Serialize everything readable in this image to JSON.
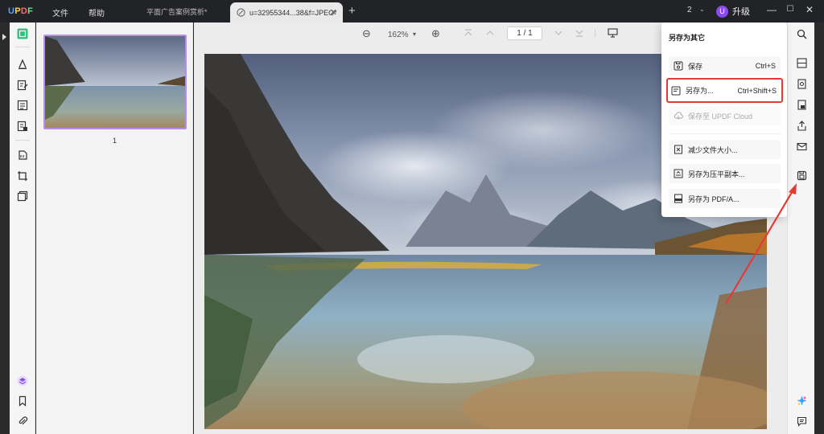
{
  "app": {
    "logo": {
      "p1": "U",
      "p2": "P",
      "p3": "D",
      "p4": "F"
    },
    "menu": {
      "file": "文件",
      "help": "帮助"
    },
    "tabs": [
      {
        "label": "平面广告案例赏析*"
      },
      {
        "label": "u=32955344...38&f=JPEG*"
      }
    ],
    "new_tab": "+",
    "tab_count": "2",
    "tab_count_caret": "⌄",
    "upgrade": {
      "avatar": "U",
      "label": "升级"
    },
    "window": {
      "minimize": "—",
      "maximize": "☐",
      "close": "✕"
    }
  },
  "viewer": {
    "zoom_out": "⊖",
    "zoom_level": "162%",
    "zoom_caret": "▾",
    "zoom_in": "⊕",
    "page_indicator": "1 / 1",
    "thumbnail_page_number": "1"
  },
  "save_popup": {
    "title": "另存为其它",
    "items": [
      {
        "label": "保存",
        "shortcut": "Ctrl+S",
        "icon": "save-icon",
        "enabled": true
      },
      {
        "label": "另存为...",
        "shortcut": "Ctrl+Shift+S",
        "icon": "save-as-icon",
        "enabled": true,
        "highlighted": true
      },
      {
        "label": "保存至 UPDF Cloud",
        "shortcut": "",
        "icon": "cloud-icon",
        "enabled": false
      },
      {
        "label": "减少文件大小...",
        "shortcut": "",
        "icon": "compress-icon",
        "enabled": true
      },
      {
        "label": "另存为压平副本...",
        "shortcut": "",
        "icon": "flatten-icon",
        "enabled": true
      },
      {
        "label": "另存为 PDF/A...",
        "shortcut": "",
        "icon": "pdfa-icon",
        "enabled": true
      }
    ]
  },
  "colors": {
    "accent": "#8a4cf0",
    "highlight_border": "#e53935",
    "annotation_arrow": "#e53935"
  }
}
